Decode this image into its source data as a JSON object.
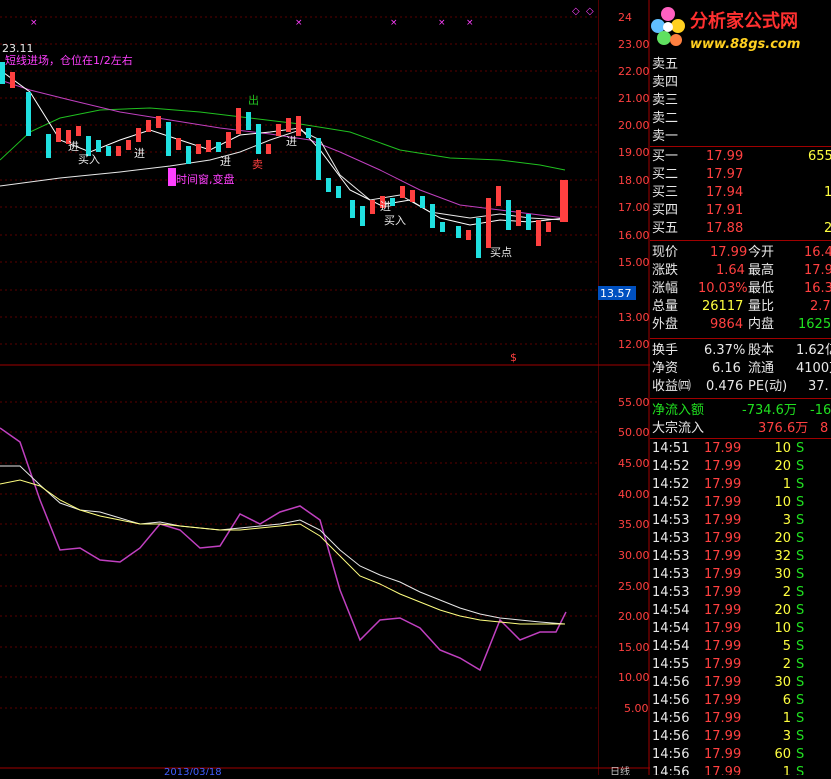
{
  "top_price_label": "23.11",
  "hint_text": "短线进场，仓位在1/2左右",
  "annotations": {
    "chu": "出",
    "jin": "进",
    "mairu": "买入",
    "mai": "卖",
    "shijianchuang": "时间窗,变盘",
    "maidian": "买点",
    "dollar": "$"
  },
  "axis_upper": [
    "24",
    "23.00",
    "22.00",
    "21.00",
    "20.00",
    "19.00",
    "18.00",
    "17.00",
    "16.00",
    "15.00",
    "14.00",
    "13.00",
    "12.00"
  ],
  "axis_lower": [
    "55.00",
    "50.00",
    "45.00",
    "40.00",
    "35.00",
    "30.00",
    "25.00",
    "20.00",
    "15.00",
    "10.00",
    "5.00"
  ],
  "current_price_tag": "13.57",
  "bottom_axis_label": "日线",
  "bottom_date_label": "2013/03/18",
  "logo": {
    "name": "分析家公式网",
    "url": "www.88gs.com"
  },
  "order_book": {
    "sell": [
      {
        "label": "卖五"
      },
      {
        "label": "卖四"
      },
      {
        "label": "卖三"
      },
      {
        "label": "卖二"
      },
      {
        "label": "卖一"
      }
    ],
    "buy": [
      {
        "label": "买一",
        "price": "17.99",
        "vol": "655"
      },
      {
        "label": "买二",
        "price": "17.97",
        "vol": ""
      },
      {
        "label": "买三",
        "price": "17.94",
        "vol": "1"
      },
      {
        "label": "买四",
        "price": "17.91",
        "vol": ""
      },
      {
        "label": "买五",
        "price": "17.88",
        "vol": "2"
      }
    ]
  },
  "quote": [
    {
      "l1": "现价",
      "v1": "17.99",
      "l2": "今开",
      "v2": "16.4"
    },
    {
      "l1": "涨跌",
      "v1": "1.64",
      "l2": "最高",
      "v2": "17.9"
    },
    {
      "l1": "涨幅",
      "v1": "10.03%",
      "l2": "最低",
      "v2": "16.3"
    },
    {
      "l1": "总量",
      "v1": "26117",
      "l2": "量比",
      "v2": "2.7"
    },
    {
      "l1": "外盘",
      "v1": "9864",
      "l2": "内盘",
      "v2": "1625"
    }
  ],
  "fundamentals": [
    {
      "l1": "换手",
      "v1": "6.37%",
      "l2": "股本",
      "v2": "1.62亿"
    },
    {
      "l1": "净资",
      "v1": "6.16",
      "l2": "流通",
      "v2": "4100万"
    },
    {
      "l1": "收益㈣",
      "v1": "0.476",
      "l2": "PE(动)",
      "v2": "37."
    }
  ],
  "flows": [
    {
      "label": "净流入额",
      "v1": "-734.6万",
      "v2": "-16"
    },
    {
      "label": "大宗流入",
      "v1": "376.6万",
      "v2": "8"
    }
  ],
  "ticks": [
    {
      "time": "14:51",
      "price": "17.99",
      "vol": "10",
      "side": "S"
    },
    {
      "time": "14:52",
      "price": "17.99",
      "vol": "20",
      "side": "S"
    },
    {
      "time": "14:52",
      "price": "17.99",
      "vol": "1",
      "side": "S"
    },
    {
      "time": "14:52",
      "price": "17.99",
      "vol": "10",
      "side": "S"
    },
    {
      "time": "14:53",
      "price": "17.99",
      "vol": "3",
      "side": "S"
    },
    {
      "time": "14:53",
      "price": "17.99",
      "vol": "20",
      "side": "S"
    },
    {
      "time": "14:53",
      "price": "17.99",
      "vol": "32",
      "side": "S"
    },
    {
      "time": "14:53",
      "price": "17.99",
      "vol": "30",
      "side": "S"
    },
    {
      "time": "14:53",
      "price": "17.99",
      "vol": "2",
      "side": "S"
    },
    {
      "time": "14:54",
      "price": "17.99",
      "vol": "20",
      "side": "S"
    },
    {
      "time": "14:54",
      "price": "17.99",
      "vol": "10",
      "side": "S"
    },
    {
      "time": "14:54",
      "price": "17.99",
      "vol": "5",
      "side": "S"
    },
    {
      "time": "14:55",
      "price": "17.99",
      "vol": "2",
      "side": "S"
    },
    {
      "time": "14:56",
      "price": "17.99",
      "vol": "30",
      "side": "S"
    },
    {
      "time": "14:56",
      "price": "17.99",
      "vol": "6",
      "side": "S"
    },
    {
      "time": "14:56",
      "price": "17.99",
      "vol": "1",
      "side": "S"
    },
    {
      "time": "14:56",
      "price": "17.99",
      "vol": "3",
      "side": "S"
    },
    {
      "time": "14:56",
      "price": "17.99",
      "vol": "60",
      "side": "S"
    },
    {
      "time": "14:56",
      "price": "17.99",
      "vol": "1",
      "side": "S"
    }
  ],
  "colors": {
    "up": "#ff4040",
    "down": "#20e0e0",
    "bg": "#000000",
    "grid": "#a00000"
  }
}
